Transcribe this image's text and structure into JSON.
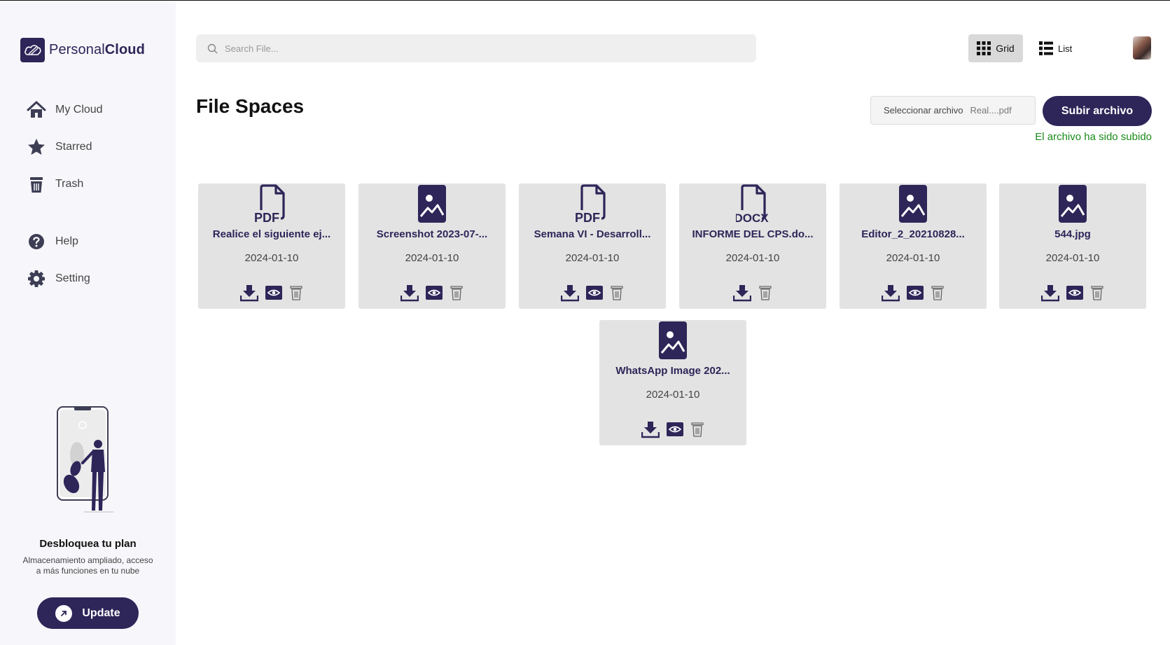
{
  "app": {
    "logo_text_regular": "Personal",
    "logo_text_bold": "Cloud"
  },
  "sidebar": {
    "items": [
      {
        "label": "My Cloud",
        "icon": "home-icon"
      },
      {
        "label": "Starred",
        "icon": "star-icon"
      },
      {
        "label": "Trash",
        "icon": "trash-icon"
      },
      {
        "label": "Help",
        "icon": "help-icon"
      },
      {
        "label": "Setting",
        "icon": "gear-icon"
      }
    ],
    "promo": {
      "title": "Desbloquea tu plan",
      "text": "Almacenamiento ampliado, acceso a más funciones en tu nube",
      "button": "Update"
    }
  },
  "search": {
    "placeholder": "Search File..."
  },
  "view_toggle": {
    "grid_label": "Grid",
    "list_label": "List",
    "selected": "Grid"
  },
  "main": {
    "title": "File Spaces",
    "file_picker": {
      "button_label": "Seleccionar archivo",
      "selected_file": "Real....pdf"
    },
    "upload_button": "Subir archivo",
    "upload_status": "El archivo ha sido subido"
  },
  "files": [
    {
      "name": "Realice el siguiente ej...",
      "date": "2024-01-10",
      "type": "pdf",
      "icon_label": "PDF",
      "preview": true
    },
    {
      "name": "Screenshot 2023-07-...",
      "date": "2024-01-10",
      "type": "image",
      "icon_label": "",
      "preview": true
    },
    {
      "name": "Semana VI - Desarroll...",
      "date": "2024-01-10",
      "type": "pdf",
      "icon_label": "PDF",
      "preview": true
    },
    {
      "name": "INFORME DEL CPS.do...",
      "date": "2024-01-10",
      "type": "docx",
      "icon_label": "DOCX",
      "preview": false
    },
    {
      "name": "Editor_2_20210828...",
      "date": "2024-01-10",
      "type": "image",
      "icon_label": "",
      "preview": true
    },
    {
      "name": "544.jpg",
      "date": "2024-01-10",
      "type": "image",
      "icon_label": "",
      "preview": true
    },
    {
      "name": "WhatsApp Image 202...",
      "date": "2024-01-10",
      "type": "image",
      "icon_label": "",
      "preview": true
    }
  ],
  "colors": {
    "brand": "#2e2558",
    "card_bg": "#e3e3e3",
    "success": "#1a8a1a",
    "sidebar_bg": "#f7f7fb"
  }
}
